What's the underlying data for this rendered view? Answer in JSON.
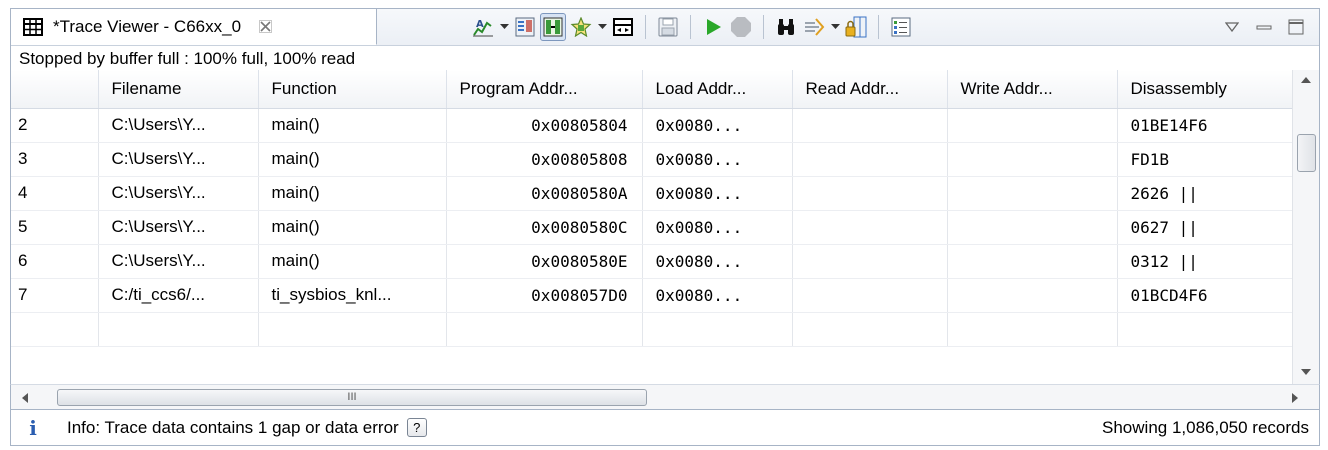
{
  "view": {
    "title": "*Trace Viewer - C66xx_0",
    "status": "Stopped by buffer full : 100% full, 100% read"
  },
  "toolbar": {
    "icons": [
      "analysis-icon",
      "dropdown-arrow-icon",
      "columns-settings-icon",
      "group-icon",
      "filter-icon",
      "dropdown-arrow-icon",
      "synchronize-icon",
      "save-icon",
      "run-icon",
      "stop-icon",
      "find-icon",
      "search-icon",
      "dropdown-arrow-icon",
      "lock-icon",
      "properties-icon"
    ]
  },
  "table": {
    "columns": [
      "Filename",
      "Function",
      "Program Addr...",
      "Load Addr...",
      "Read Addr...",
      "Write Addr...",
      "Disassembly"
    ],
    "rows": [
      {
        "index": "2",
        "filename": "C:\\Users\\Y...",
        "function": "main()",
        "program": "0x00805804",
        "load": "0x0080...",
        "read": "",
        "write": "",
        "disasm": "01BE14F6"
      },
      {
        "index": "3",
        "filename": "C:\\Users\\Y...",
        "function": "main()",
        "program": "0x00805808",
        "load": "0x0080...",
        "read": "",
        "write": "",
        "disasm": "FD1B"
      },
      {
        "index": "4",
        "filename": "C:\\Users\\Y...",
        "function": "main()",
        "program": "0x0080580A",
        "load": "0x0080...",
        "read": "",
        "write": "",
        "disasm": "2626 ||"
      },
      {
        "index": "5",
        "filename": "C:\\Users\\Y...",
        "function": "main()",
        "program": "0x0080580C",
        "load": "0x0080...",
        "read": "",
        "write": "",
        "disasm": "0627 ||"
      },
      {
        "index": "6",
        "filename": "C:\\Users\\Y...",
        "function": "main()",
        "program": "0x0080580E",
        "load": "0x0080...",
        "read": "",
        "write": "",
        "disasm": "0312 ||"
      },
      {
        "index": "7",
        "filename": "C:/ti_ccs6/...",
        "function": "ti_sysbios_knl...",
        "program": "0x008057D0",
        "load": "0x0080...",
        "read": "",
        "write": "",
        "disasm": "01BCD4F6"
      }
    ]
  },
  "scrollbar": {
    "grip": "III"
  },
  "footer": {
    "info": "Info: Trace data contains 1 gap or data error",
    "help": "?",
    "records": "Showing 1,086,050 records"
  }
}
